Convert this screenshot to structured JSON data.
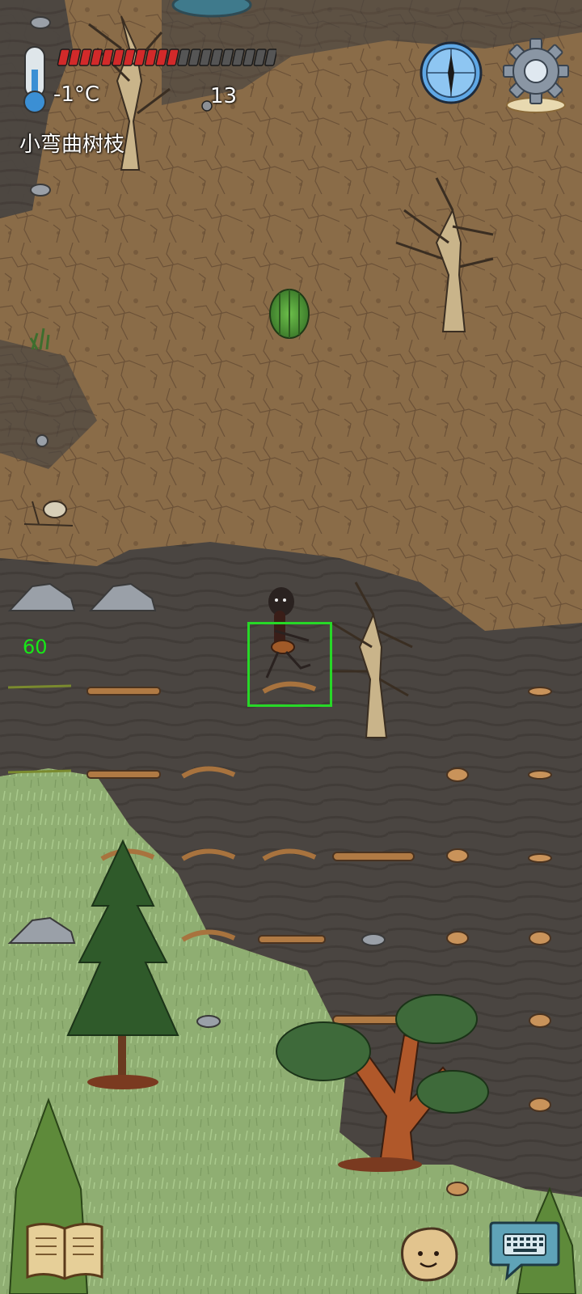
{
  "hud": {
    "temperature": "-1°C",
    "rock_count": "13",
    "held_item": "小弯曲树枝",
    "fps": "60",
    "health_fraction": 0.55,
    "health_segments": 20,
    "health_filled": 11,
    "colors": {
      "health_fill": "#d22a2a",
      "health_empty": "#555555",
      "fps_text": "#17e817",
      "selection": "#27d827"
    }
  },
  "icons": {
    "thermometer": "thermometer-icon",
    "compass": "compass-icon",
    "settings": "gear-icon",
    "journal": "book-icon",
    "emote": "potato-face-icon",
    "keyboard": "keyboard-icon"
  }
}
